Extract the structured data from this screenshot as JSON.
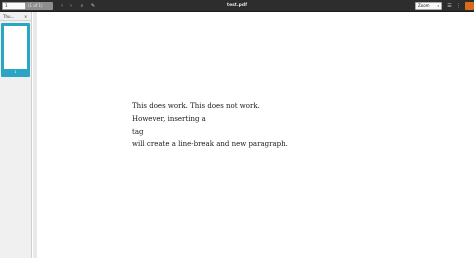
{
  "header": {
    "page_value": "1",
    "page_of": "(1 of 1)",
    "title": "test.pdf",
    "zoom": "Zoom",
    "buttons": {
      "prev": "‹",
      "next": "›",
      "search": "⌕",
      "annotate": "✎",
      "zoom_arrow": "▾",
      "menu": "☰",
      "extra": "⋮"
    }
  },
  "sidebar": {
    "tab_label": "Thu...",
    "tab_close": "×",
    "thumbnail_page": "1"
  },
  "document": {
    "lines": [
      "This does work. This does not work.",
      "However, inserting a",
      "tag",
      "will create a line-break and new paragraph."
    ]
  },
  "colors": {
    "header_bg": "#2d2d2d",
    "accent": "#d86a1c",
    "thumbnail_selected": "#2aa6c4"
  }
}
